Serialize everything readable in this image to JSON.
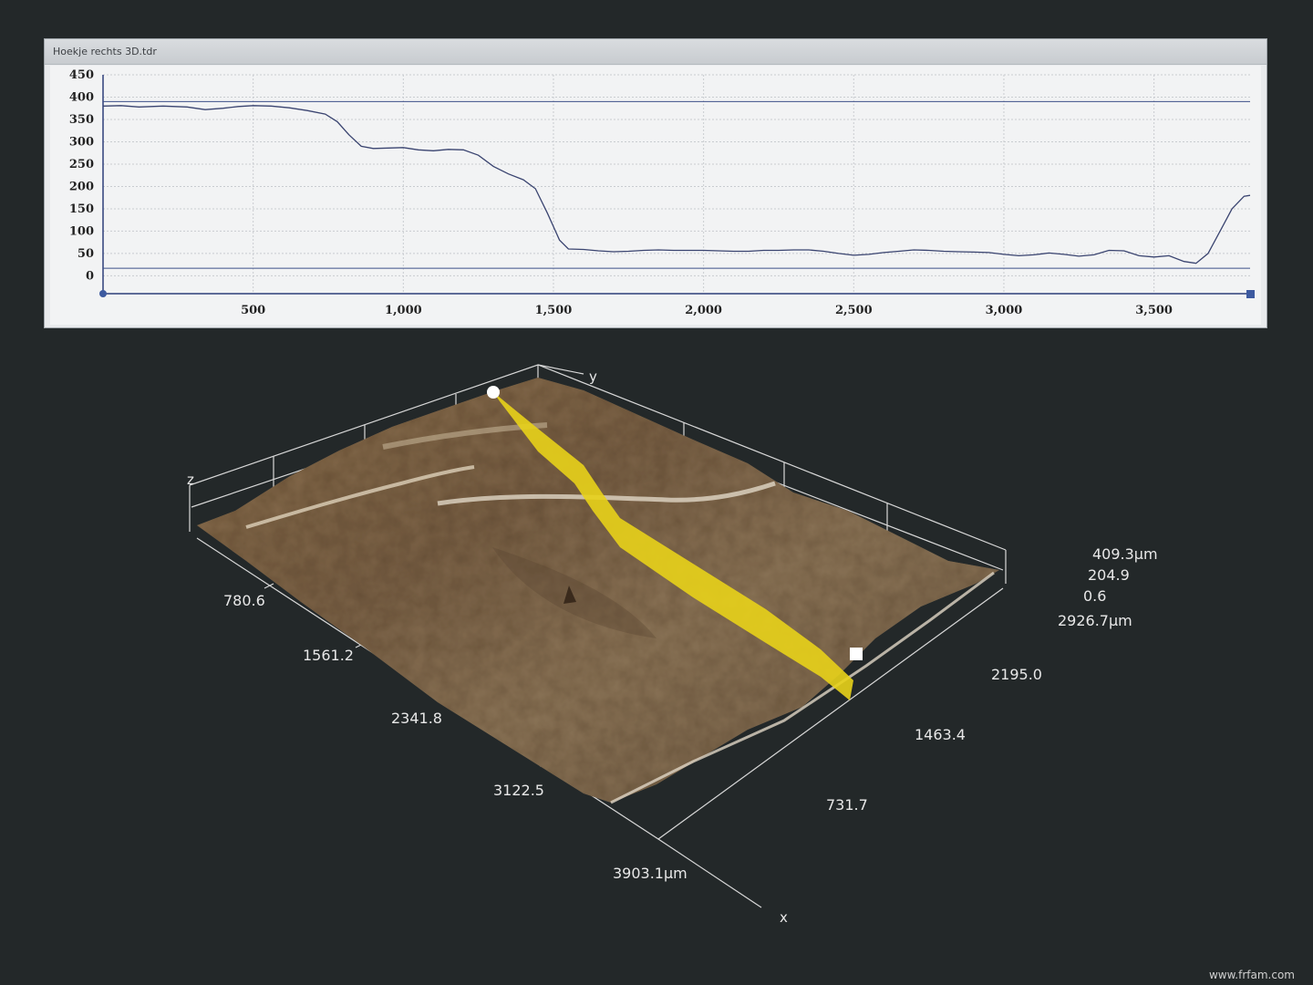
{
  "window": {
    "title": "Hoekje rechts 3D.tdr"
  },
  "chart_data": {
    "type": "line",
    "xlim": [
      0,
      3820
    ],
    "ylim": [
      -40,
      450
    ],
    "xticks": [
      500,
      1000,
      1500,
      2000,
      2500,
      3000,
      3500
    ],
    "xtick_labels": [
      "500",
      "1,000",
      "1,500",
      "2,000",
      "2,500",
      "3,000",
      "3,500"
    ],
    "yticks": [
      0,
      50,
      100,
      150,
      200,
      250,
      300,
      350,
      400,
      450
    ],
    "ytick_labels": [
      "0",
      "50",
      "100",
      "150",
      "200",
      "250",
      "300",
      "350",
      "400",
      "450"
    ],
    "grid": true,
    "reference_lines": [
      390,
      17
    ],
    "series": [
      {
        "x": [
          0,
          60,
          120,
          200,
          280,
          340,
          400,
          450,
          500,
          560,
          620,
          680,
          740,
          780,
          820,
          860,
          900,
          950,
          1000,
          1050,
          1100,
          1150,
          1200,
          1250,
          1300,
          1350,
          1400,
          1440,
          1480,
          1520,
          1550,
          1600,
          1650,
          1700,
          1750,
          1800,
          1850,
          1900,
          1950,
          2000,
          2050,
          2100,
          2150,
          2200,
          2250,
          2300,
          2350,
          2400,
          2450,
          2500,
          2550,
          2600,
          2650,
          2700,
          2750,
          2800,
          2850,
          2900,
          2950,
          3000,
          3050,
          3100,
          3150,
          3200,
          3250,
          3300,
          3350,
          3400,
          3450,
          3500,
          3550,
          3600,
          3640,
          3680,
          3720,
          3760,
          3800,
          3820
        ],
        "values": [
          380,
          381,
          378,
          380,
          378,
          372,
          375,
          379,
          381,
          380,
          376,
          370,
          362,
          345,
          315,
          290,
          285,
          286,
          287,
          282,
          280,
          283,
          282,
          270,
          245,
          228,
          215,
          195,
          140,
          80,
          60,
          59,
          56,
          54,
          55,
          57,
          58,
          57,
          57,
          57,
          56,
          55,
          55,
          57,
          57,
          58,
          58,
          55,
          50,
          46,
          48,
          52,
          55,
          58,
          57,
          55,
          54,
          53,
          52,
          48,
          45,
          47,
          51,
          48,
          44,
          47,
          57,
          56,
          45,
          42,
          45,
          32,
          28,
          50,
          100,
          150,
          178,
          180
        ]
      }
    ]
  },
  "view3d": {
    "axis_letters": {
      "x": "x",
      "y": "y",
      "z": "z"
    },
    "x_ticks": [
      "780.6",
      "1561.2",
      "2341.8",
      "3122.5",
      "3903.1µm"
    ],
    "y_ticks": [
      "731.7",
      "1463.4",
      "2195.0",
      "2926.7µm"
    ],
    "z_ticks": [
      "409.3µm",
      "204.9",
      "0.6"
    ]
  },
  "watermark": "www.frfam.com"
}
